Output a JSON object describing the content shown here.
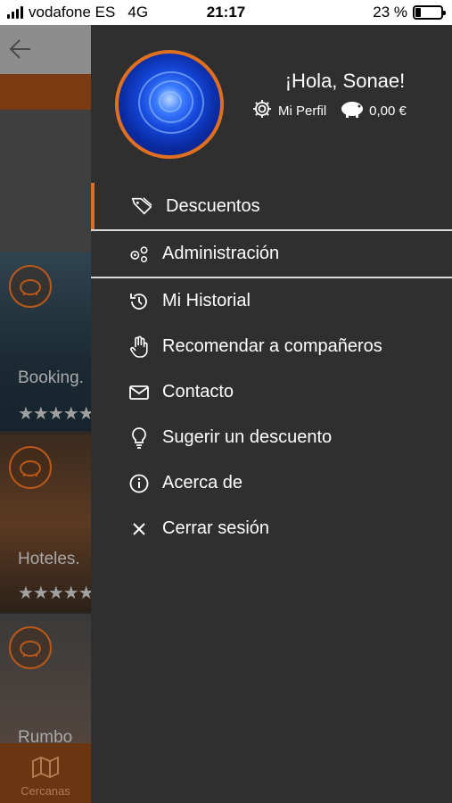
{
  "status_bar": {
    "carrier": "vodafone ES",
    "network": "4G",
    "time": "21:17",
    "battery": "23 %",
    "battery_level": 0.23
  },
  "background": {
    "cards": [
      {
        "title": "Booking.",
        "stars": "★★★★★"
      },
      {
        "title": "Hoteles.",
        "stars": "★★★★★"
      },
      {
        "title": "Rumbo"
      }
    ],
    "bottom_nav_label": "Cercanas"
  },
  "drawer": {
    "greeting": "¡Hola, Sonae!",
    "profile_label": "Mi Perfil",
    "balance": "0,00 €",
    "menu": [
      {
        "label": "Descuentos",
        "icon": "tag-icon"
      },
      {
        "label": "Administración",
        "icon": "gears-icon"
      },
      {
        "label": "Mi Historial",
        "icon": "history-icon"
      },
      {
        "label": "Recomendar a compañeros",
        "icon": "hand-icon"
      },
      {
        "label": "Contacto",
        "icon": "envelope-icon"
      },
      {
        "label": "Sugerir un descuento",
        "icon": "lightbulb-icon"
      },
      {
        "label": "Acerca de",
        "icon": "info-icon"
      },
      {
        "label": "Cerrar sesión",
        "icon": "close-icon"
      }
    ]
  },
  "colors": {
    "accent": "#e07020",
    "drawer_bg": "#2f2f2f"
  }
}
